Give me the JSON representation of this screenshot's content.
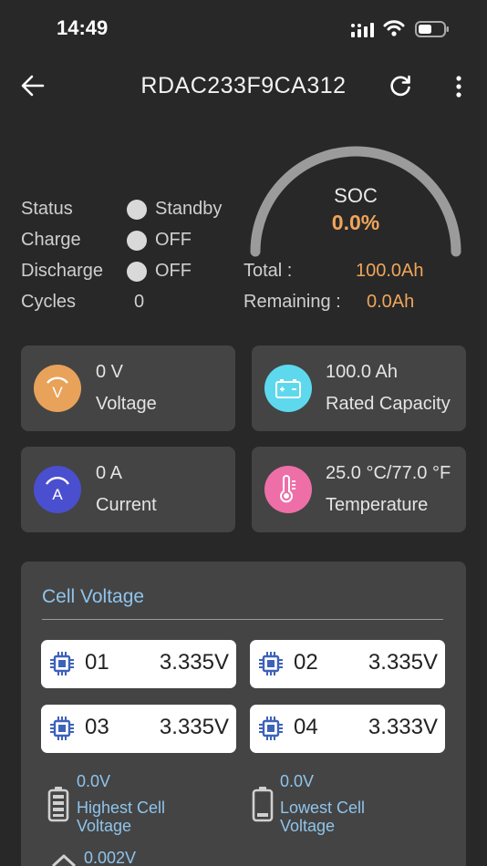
{
  "status_bar": {
    "time": "14:49"
  },
  "header": {
    "title": "RDAC233F9CA312"
  },
  "info": {
    "status_label": "Status",
    "status_value": "Standby",
    "charge_label": "Charge",
    "charge_value": "OFF",
    "discharge_label": "Discharge",
    "discharge_value": "OFF",
    "cycles_label": "Cycles",
    "cycles_value": "0"
  },
  "soc": {
    "label": "SOC",
    "value": "0.0%",
    "fraction": 0.0,
    "total_label": "Total :",
    "total_value": "100.0Ah",
    "remaining_label": "Remaining :",
    "remaining_value": "0.0Ah"
  },
  "metrics": {
    "voltage": {
      "value": "0 V",
      "name": "Voltage",
      "color": "#e8a25a",
      "icon": "voltage-icon"
    },
    "capacity": {
      "value": "100.0 Ah",
      "name": "Rated Capacity",
      "color": "#5ed8ec",
      "icon": "battery-capacity-icon"
    },
    "current": {
      "value": "0 A",
      "name": "Current",
      "color": "#4a4fcf",
      "icon": "current-icon"
    },
    "temperature": {
      "value": "25.0 °C/77.0 °F",
      "name": "Temperature",
      "color": "#ee6fa8",
      "icon": "thermometer-icon"
    }
  },
  "cells": {
    "title": "Cell Voltage",
    "items": [
      {
        "num": "01",
        "voltage": "3.335V"
      },
      {
        "num": "02",
        "voltage": "3.335V"
      },
      {
        "num": "03",
        "voltage": "3.335V"
      },
      {
        "num": "04",
        "voltage": "3.333V"
      }
    ],
    "highest_value": "0.0V",
    "highest_label_1": "Highest Cell",
    "highest_label_2": "Voltage",
    "lowest_value": "0.0V",
    "lowest_label_1": "Lowest Cell",
    "lowest_label_2": "Voltage",
    "diff_value": "0.002V"
  },
  "colors": {
    "accent": "#f0a55a",
    "cell_text": "#8fc4ec",
    "background": "#282828",
    "card": "#444444"
  }
}
